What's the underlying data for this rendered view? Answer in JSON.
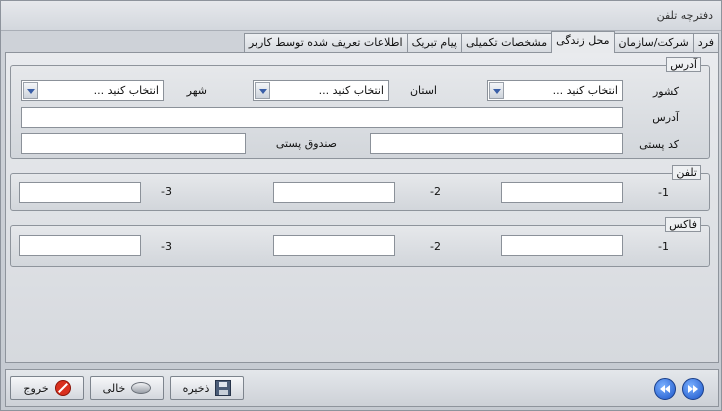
{
  "window": {
    "title": "دفترچه تلفن"
  },
  "tabs": [
    {
      "label": "فرد"
    },
    {
      "label": "شرکت/سازمان"
    },
    {
      "label": "محل زندگی"
    },
    {
      "label": "مشخصات تکمیلی"
    },
    {
      "label": "پیام تبریک"
    },
    {
      "label": "اطلاعات تعریف شده توسط کاربر"
    }
  ],
  "active_tab": "محل زندگی",
  "address": {
    "caption": "آدرس",
    "country_label": "کشور",
    "province_label": "استان",
    "city_label": "شهر",
    "country_value": "انتخاب کنید ...",
    "province_value": "انتخاب کنید ...",
    "city_value": "انتخاب کنید ...",
    "address_label": "آدرس",
    "address_value": "",
    "postal_code_label": "کد پستی",
    "postal_code_value": "",
    "po_box_label": "صندوق پستی",
    "po_box_value": ""
  },
  "phone": {
    "caption": "تلفن",
    "label_1": "-1",
    "label_2": "-2",
    "label_3": "-3",
    "value_1": "",
    "value_2": "",
    "value_3": ""
  },
  "fax": {
    "caption": "فاکس",
    "label_1": "-1",
    "label_2": "-2",
    "label_3": "-3",
    "value_1": "",
    "value_2": "",
    "value_3": ""
  },
  "toolbar": {
    "save_label": "ذخیره",
    "clear_label": "خالی",
    "exit_label": "خروج"
  },
  "icons": {
    "save": "floppy-disk-icon",
    "clear": "eraser-icon",
    "exit": "no-entry-icon",
    "next": "double-right-arrow-icon",
    "prev": "double-left-arrow-icon"
  }
}
